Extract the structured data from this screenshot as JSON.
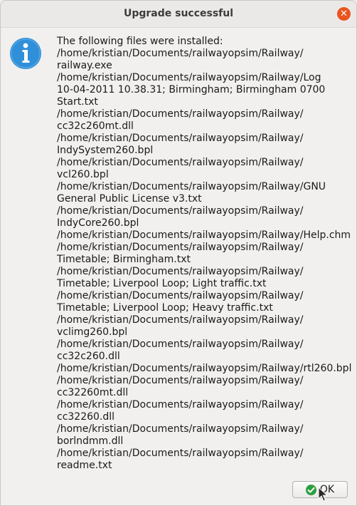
{
  "dialog": {
    "title": "Upgrade successful",
    "close_glyph": "✕",
    "icon": "info-icon",
    "message_lines": [
      "The following files were installed:",
      "/home/kristian/Documents/railwayopsim/Railway/",
      "railway.exe",
      "/home/kristian/Documents/railwayopsim/Railway/Log",
      "10-04-2011 10.38.31; Birmingham; Birmingham 0700",
      "Start.txt",
      "/home/kristian/Documents/railwayopsim/Railway/",
      "cc32c260mt.dll",
      "/home/kristian/Documents/railwayopsim/Railway/",
      "IndySystem260.bpl",
      "/home/kristian/Documents/railwayopsim/Railway/",
      "vcl260.bpl",
      "/home/kristian/Documents/railwayopsim/Railway/GNU",
      "General Public License v3.txt",
      "/home/kristian/Documents/railwayopsim/Railway/",
      "IndyCore260.bpl",
      "/home/kristian/Documents/railwayopsim/Railway/Help.chm",
      "/home/kristian/Documents/railwayopsim/Railway/",
      "Timetable; Birmingham.txt",
      "/home/kristian/Documents/railwayopsim/Railway/",
      "Timetable; Liverpool Loop; Light traffic.txt",
      "/home/kristian/Documents/railwayopsim/Railway/",
      "Timetable; Liverpool Loop; Heavy traffic.txt",
      "/home/kristian/Documents/railwayopsim/Railway/",
      "vclimg260.bpl",
      "/home/kristian/Documents/railwayopsim/Railway/",
      "cc32c260.dll",
      "/home/kristian/Documents/railwayopsim/Railway/rtl260.bpl",
      "/home/kristian/Documents/railwayopsim/Railway/",
      "cc32260mt.dll",
      "/home/kristian/Documents/railwayopsim/Railway/",
      "cc32260.dll",
      "/home/kristian/Documents/railwayopsim/Railway/",
      "borlndmm.dll",
      "/home/kristian/Documents/railwayopsim/Railway/",
      "readme.txt"
    ],
    "ok_label": "OK",
    "ok_icon": "checkmark-icon"
  },
  "colors": {
    "close_button": "#e95420",
    "info_icon": "#2f8fd8",
    "ok_icon": "#2e9e3f"
  }
}
